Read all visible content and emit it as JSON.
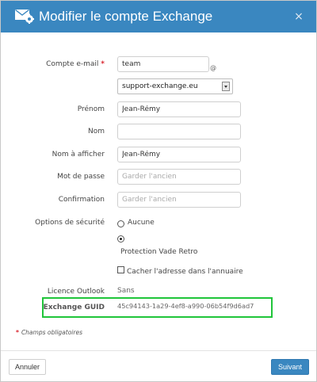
{
  "header": {
    "title": "Modifier le compte Exchange",
    "close_symbol": "×",
    "icon": "envelope-gear-icon"
  },
  "form": {
    "email_label": "Compte e-mail",
    "required_mark": "*",
    "email_value": "team",
    "at_sign": "@",
    "domain_selected": "support-exchange.eu",
    "prenom_label": "Prénom",
    "prenom_value": "Jean-Rémy",
    "nom_label": "Nom",
    "nom_value": "",
    "display_label": "Nom à afficher",
    "display_value": "Jean-Rémy",
    "password_label": "Mot de passe",
    "password_placeholder": "Garder l'ancien",
    "confirm_label": "Confirmation",
    "confirm_placeholder": "Garder l'ancien",
    "security_label": "Options de sécurité",
    "security_options": [
      {
        "label": "Aucune",
        "checked": false
      },
      {
        "label": "Protection Vade Retro",
        "checked": true
      }
    ],
    "hide_directory_label": "Cacher l'adresse dans l'annuaire",
    "hide_directory_checked": false,
    "licence_label": "Licence Outlook",
    "licence_value": "Sans",
    "guid_label": "Exchange GUID",
    "guid_value": "45c94143-1a29-4ef8-a990-06b54f9d6ad7"
  },
  "footnote": "Champs obligatoires",
  "footer": {
    "cancel_label": "Annuler",
    "next_label": "Suivant"
  },
  "colors": {
    "header_bg": "#3a87c0",
    "required": "#d9232d",
    "highlight": "#20c53a",
    "primary_button": "#3a87c0"
  }
}
